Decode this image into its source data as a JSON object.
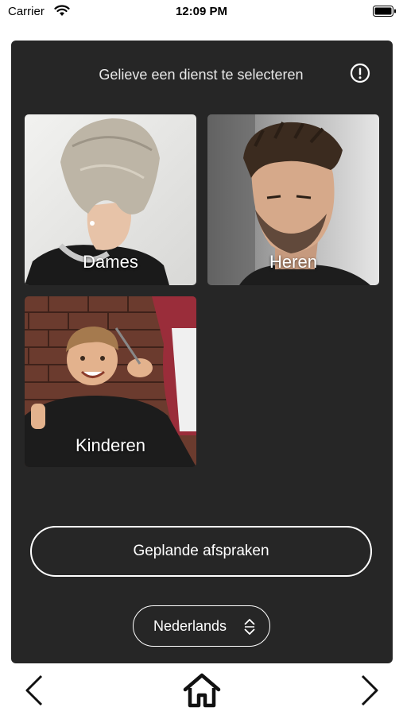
{
  "status_bar": {
    "carrier": "Carrier",
    "time": "12:09 PM",
    "icons": [
      "wifi-icon",
      "battery-icon"
    ]
  },
  "header": {
    "title": "Gelieve een dienst te selecteren",
    "info_icon": "info-icon"
  },
  "services": [
    {
      "label": "Dames"
    },
    {
      "label": "Heren"
    },
    {
      "label": "Kinderen"
    }
  ],
  "planned_button": {
    "label": "Geplande afspraken"
  },
  "language_select": {
    "selected": "Nederlands",
    "icon": "up-down-chevron-icon"
  },
  "bottom_nav": {
    "icons": [
      "chevron-left-icon",
      "home-icon",
      "chevron-right-icon"
    ]
  },
  "colors": {
    "panel_background": "#262626",
    "page_background": "#ffffff",
    "text_light": "#ffffff"
  }
}
